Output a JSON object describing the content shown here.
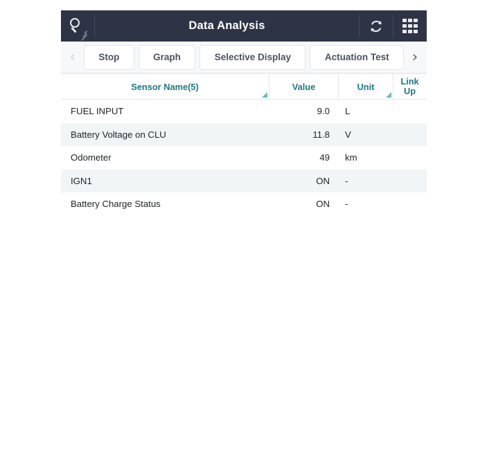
{
  "titlebar": {
    "title": "Data Analysis",
    "search_icon": "search-icon",
    "refresh_icon": "refresh-icon",
    "grid_icon": "grid-icon"
  },
  "toolbar": {
    "prev_label": "‹",
    "next_label": "›",
    "buttons": [
      {
        "label": "Stop"
      },
      {
        "label": "Graph"
      },
      {
        "label": "Selective Display"
      },
      {
        "label": "Actuation Test"
      }
    ]
  },
  "table": {
    "columns": [
      {
        "label": "Sensor Name(5)"
      },
      {
        "label": "Value"
      },
      {
        "label": "Unit"
      },
      {
        "label": "Link\nUp"
      }
    ],
    "link_up_line1": "Link",
    "link_up_line2": "Up",
    "rows": [
      {
        "name": "FUEL INPUT",
        "value": "9.0",
        "unit": "L",
        "link": ""
      },
      {
        "name": "Battery Voltage on CLU",
        "value": "11.8",
        "unit": "V",
        "link": ""
      },
      {
        "name": "Odometer",
        "value": "49",
        "unit": "km",
        "link": ""
      },
      {
        "name": "IGN1",
        "value": "ON",
        "unit": "-",
        "link": ""
      },
      {
        "name": "Battery Charge Status",
        "value": "ON",
        "unit": "-",
        "link": ""
      }
    ]
  },
  "colors": {
    "titlebar_bg": "#2e3446",
    "header_text": "#1b7a85",
    "grip": "#69b9c4",
    "alt_row": "#f1f5f6",
    "toolbar_bg": "#f7f8f9"
  }
}
